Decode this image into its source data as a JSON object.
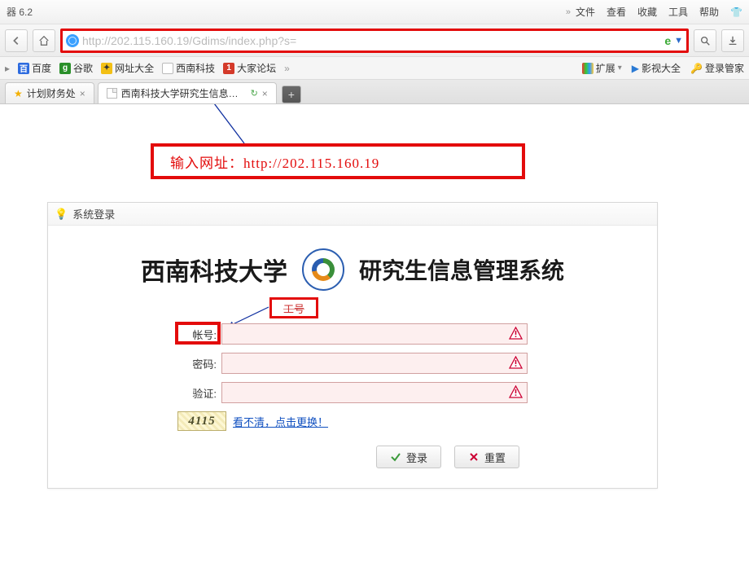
{
  "titlebar": {
    "app": "器 6.2",
    "menus": [
      "文件",
      "查看",
      "收藏",
      "工具",
      "帮助"
    ]
  },
  "address": {
    "url": "http://202.115.160.19/Gdims/index.php?s="
  },
  "bookmarks": {
    "items": [
      {
        "label": "百度",
        "bg": "#2d6bdf",
        "txt": "B"
      },
      {
        "label": "谷歌",
        "bg": "#2a8f2a",
        "txt": "G"
      },
      {
        "label": "网址大全",
        "bg": "#f3c015",
        "txt": "✦"
      },
      {
        "label": "西南科技",
        "bg": "#ffffff",
        "txt": "",
        "border": true
      },
      {
        "label": "大家论坛",
        "bg": "#d43a2a",
        "txt": "1"
      }
    ],
    "ext": "扩展",
    "video": "影视大全",
    "login": "登录管家"
  },
  "tabs": {
    "items": [
      {
        "label": "计划财务处",
        "active": false
      },
      {
        "label": "西南科技大学研究生信息管理",
        "active": true
      }
    ]
  },
  "callout": "输入网址：http://202.115.160.19",
  "panel": {
    "title": "系统登录",
    "uni": "西南科技大学",
    "sys": "研究生信息管理系统",
    "hint": "工号",
    "labels": {
      "account": "帐号:",
      "password": "密码:",
      "captcha": "验证:"
    },
    "captcha_value": "4115",
    "captcha_refresh": "看不清，点击更换！",
    "login_btn": "登录",
    "reset_btn": "重置"
  }
}
